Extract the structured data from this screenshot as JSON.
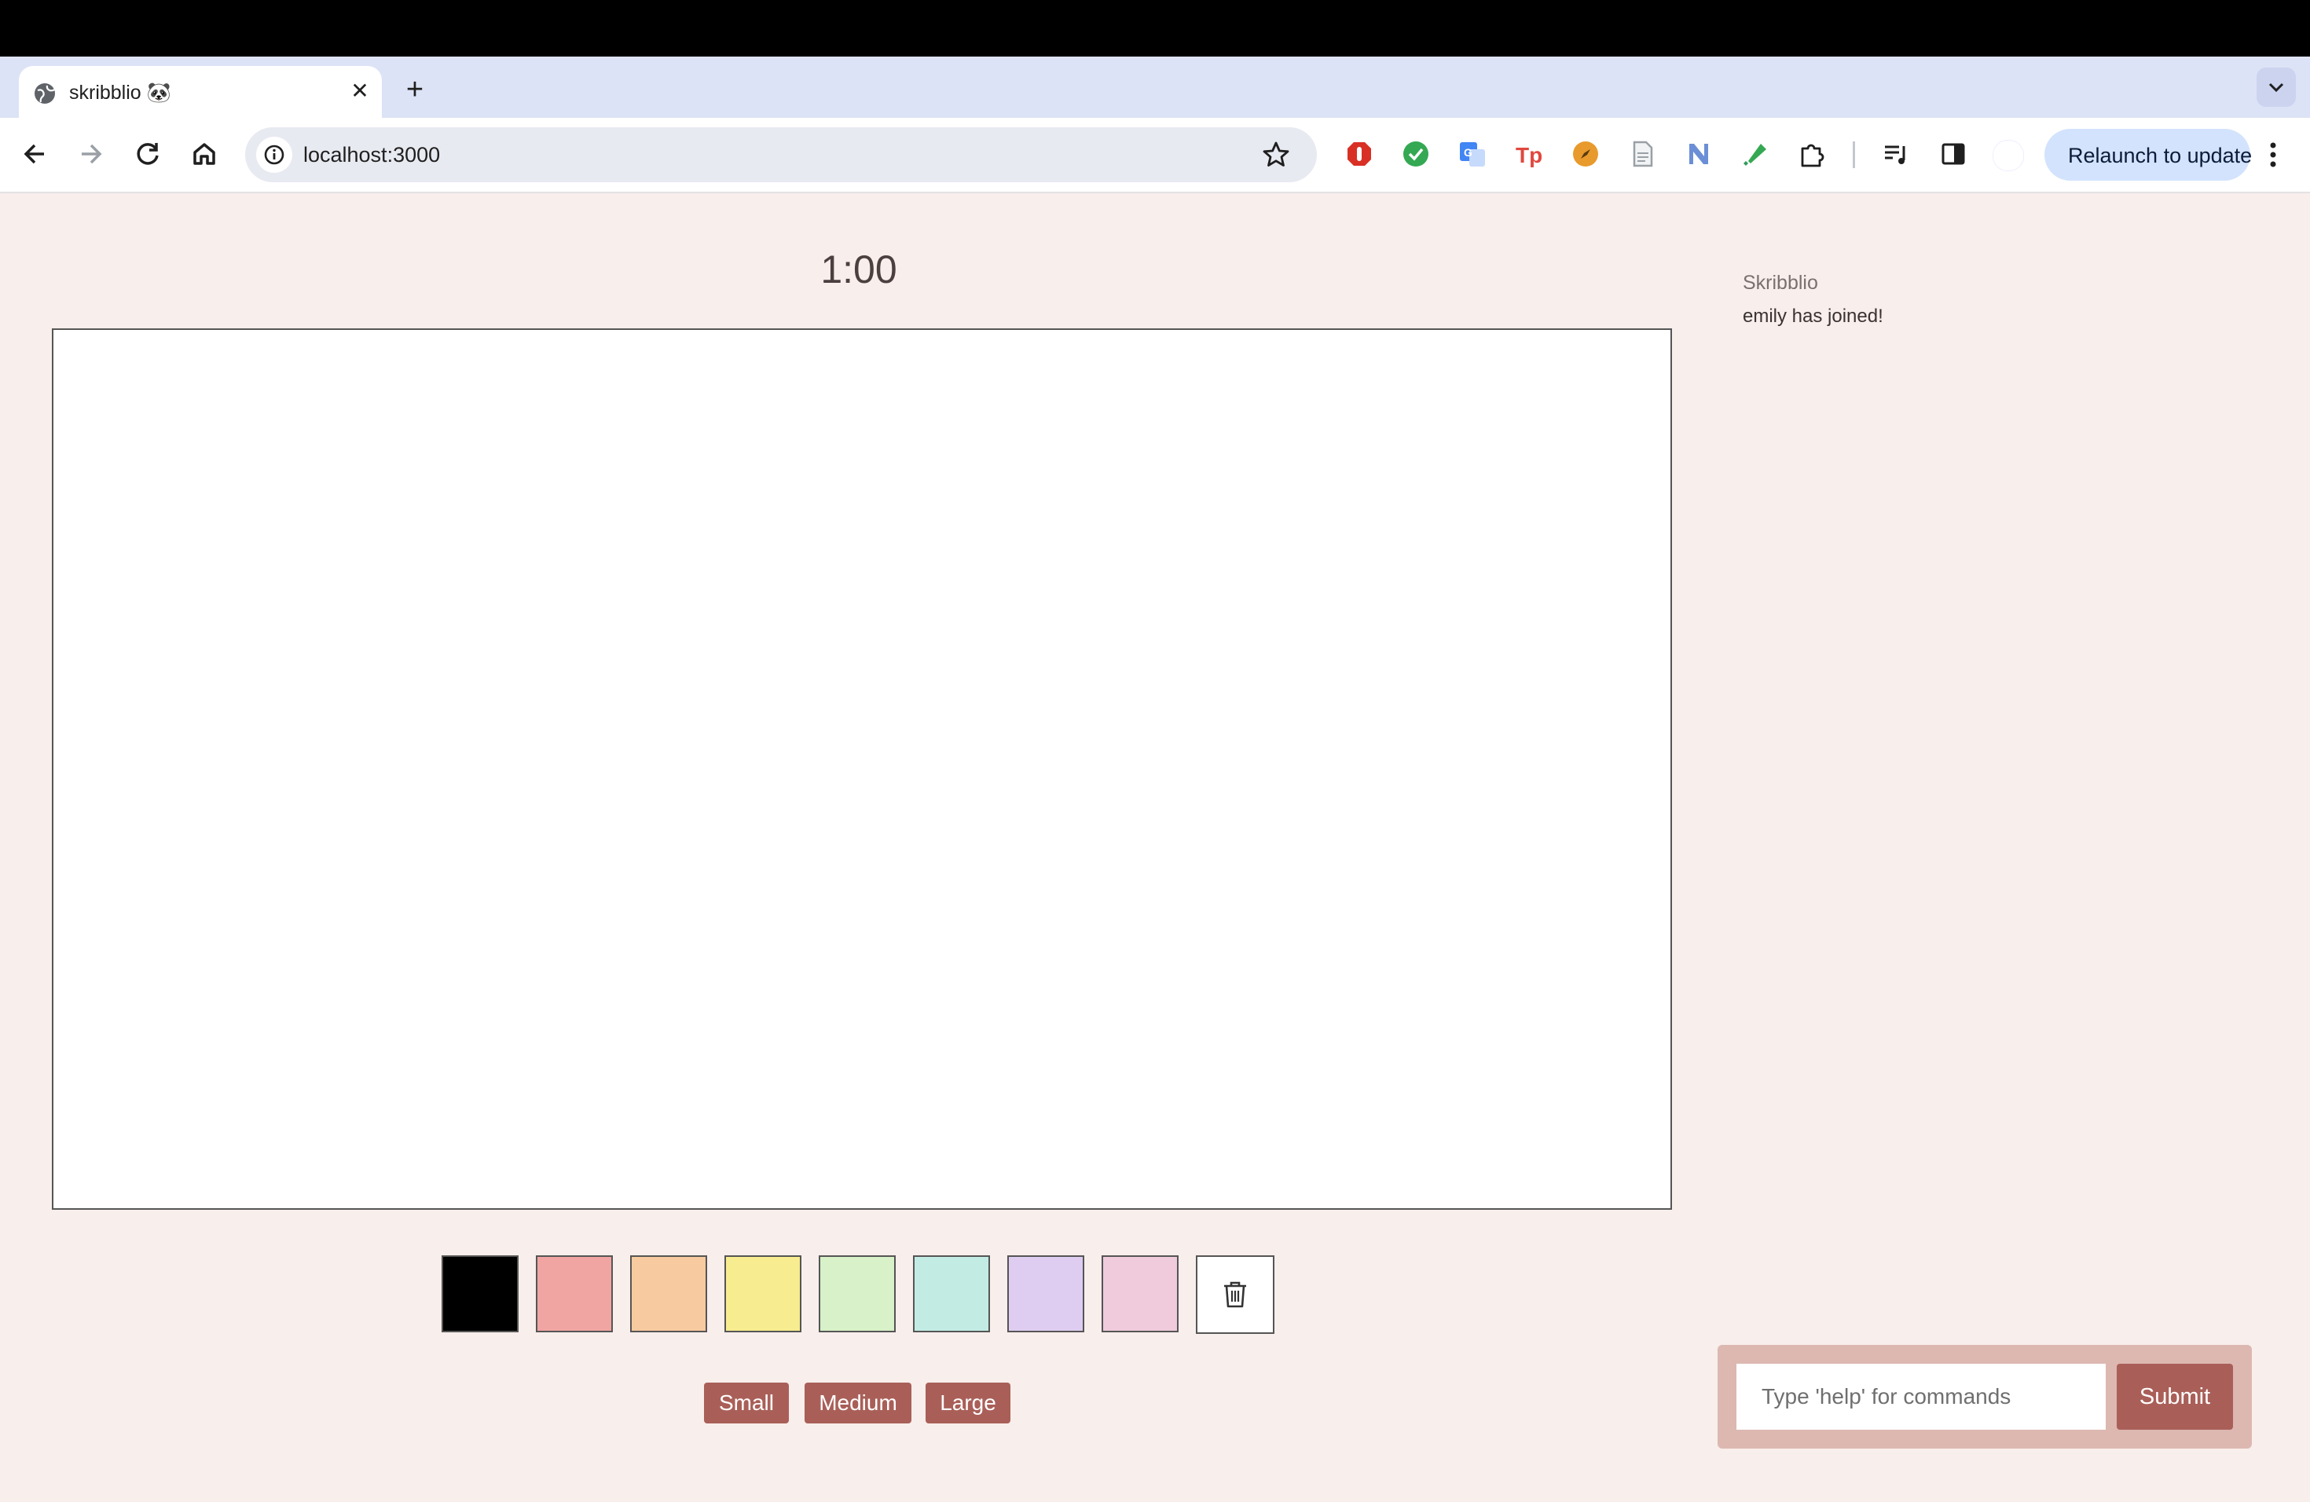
{
  "browser": {
    "tab_title": "skribblio 🐼",
    "url": "localhost:3000",
    "relaunch_label": "Relaunch to update"
  },
  "game": {
    "timer": "1:00",
    "palette": [
      "#000000",
      "#f0a5a2",
      "#f7caa0",
      "#f7ec8f",
      "#d8f1c8",
      "#c2ebe4",
      "#dfcdf1",
      "#efcbdb"
    ],
    "sizes": {
      "small": "Small",
      "medium": "Medium",
      "large": "Large"
    }
  },
  "chat": {
    "messages": [
      {
        "author": "Skribblio",
        "text": "emily has joined!"
      }
    ],
    "placeholder": "Type 'help' for commands",
    "submit_label": "Submit"
  },
  "colors": {
    "accent": "#a95f58",
    "background": "#f8eeeb",
    "chat_form": "#dcb8b1"
  },
  "icons": {
    "clear_canvas": "trash-icon"
  }
}
